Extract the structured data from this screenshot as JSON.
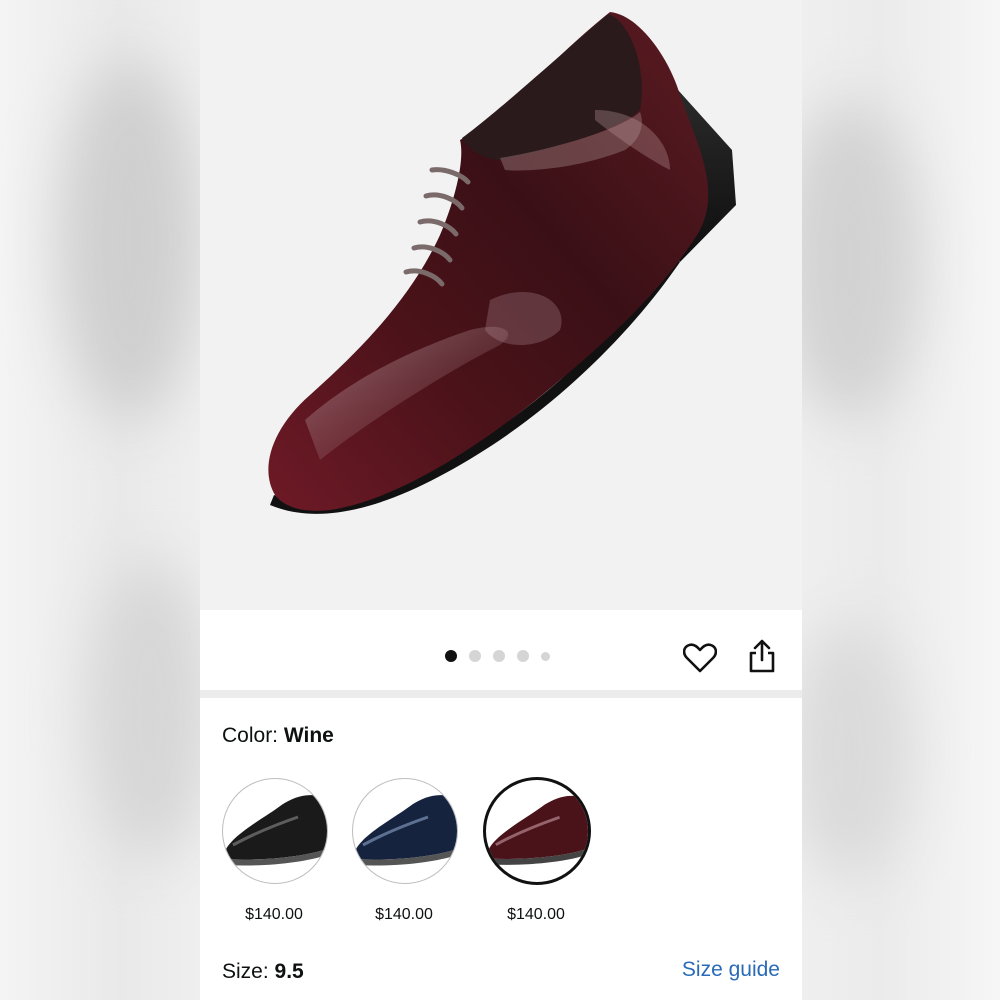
{
  "gallery": {
    "image_count": 5,
    "active_index": 0
  },
  "actions": {
    "favorite_icon": "heart-icon",
    "share_icon": "share-icon"
  },
  "color": {
    "label": "Color:",
    "value": "Wine",
    "options": [
      {
        "name": "Black",
        "price": "$140.00",
        "selected": false
      },
      {
        "name": "Blue",
        "price": "$140.00",
        "selected": false
      },
      {
        "name": "Wine",
        "price": "$140.00",
        "selected": true
      }
    ]
  },
  "size": {
    "label": "Size:",
    "value": "9.5",
    "guide_link": "Size guide"
  },
  "colors": {
    "link": "#2a6bb8",
    "text": "#0f1111",
    "wine": "#5a1620"
  }
}
